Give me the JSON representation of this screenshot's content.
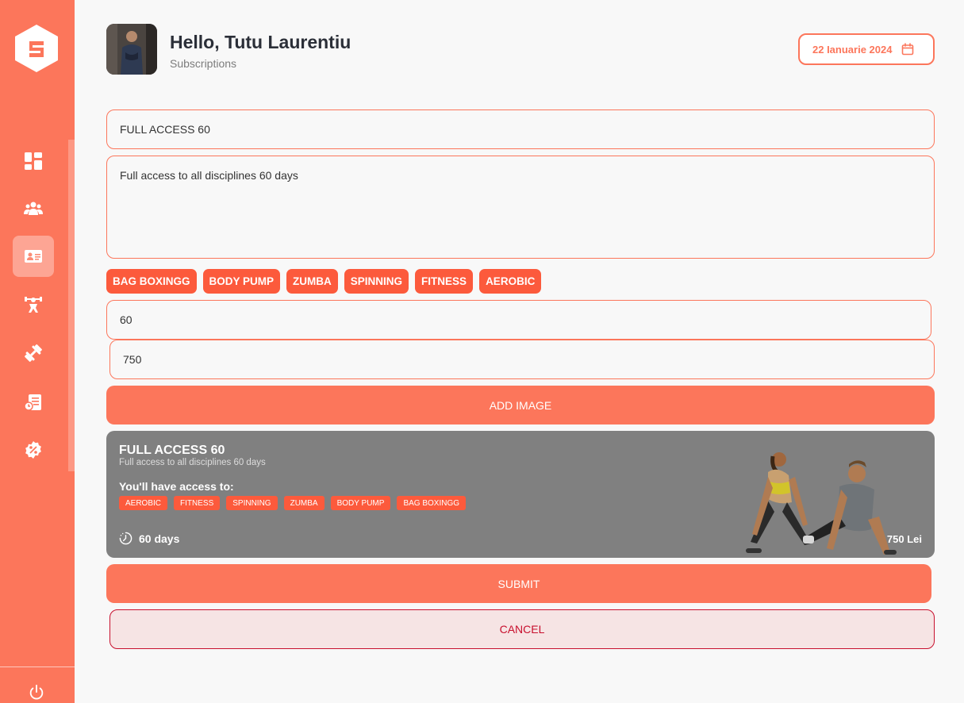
{
  "header": {
    "greeting": "Hello, Tutu Laurentiu",
    "subtitle": "Subscriptions",
    "date": "22 Ianuarie 2024"
  },
  "sidebar": {
    "items": [
      {
        "icon": "dashboard-icon"
      },
      {
        "icon": "users-icon"
      },
      {
        "icon": "id-card-icon",
        "active": true
      },
      {
        "icon": "trainer-icon"
      },
      {
        "icon": "dumbbell-icon"
      },
      {
        "icon": "report-icon"
      },
      {
        "icon": "discount-icon"
      }
    ]
  },
  "form": {
    "name_value": "FULL ACCESS 60",
    "description_value": "Full access to all disciplines 60 days",
    "disciplines": [
      "BAG BOXINGG",
      "BODY PUMP",
      "ZUMBA",
      "SPINNING",
      "FITNESS",
      "AEROBIC"
    ],
    "days_value": "60",
    "price_value": "750",
    "add_image_label": "ADD IMAGE",
    "submit_label": "SUBMIT",
    "cancel_label": "CANCEL"
  },
  "preview": {
    "title": "FULL ACCESS 60",
    "description": "Full access to all disciplines 60 days",
    "access_heading": "You'll have access to:",
    "tags": [
      "AEROBIC",
      "FITNESS",
      "SPINNING",
      "ZUMBA",
      "BODY PUMP",
      "BAG BOXINGG"
    ],
    "duration": "60 days",
    "price": "750 Lei"
  },
  "colors": {
    "accent": "#fc765b",
    "chip": "#fc5a3c",
    "cancel": "#c8102e",
    "preview_bg": "#808080"
  }
}
